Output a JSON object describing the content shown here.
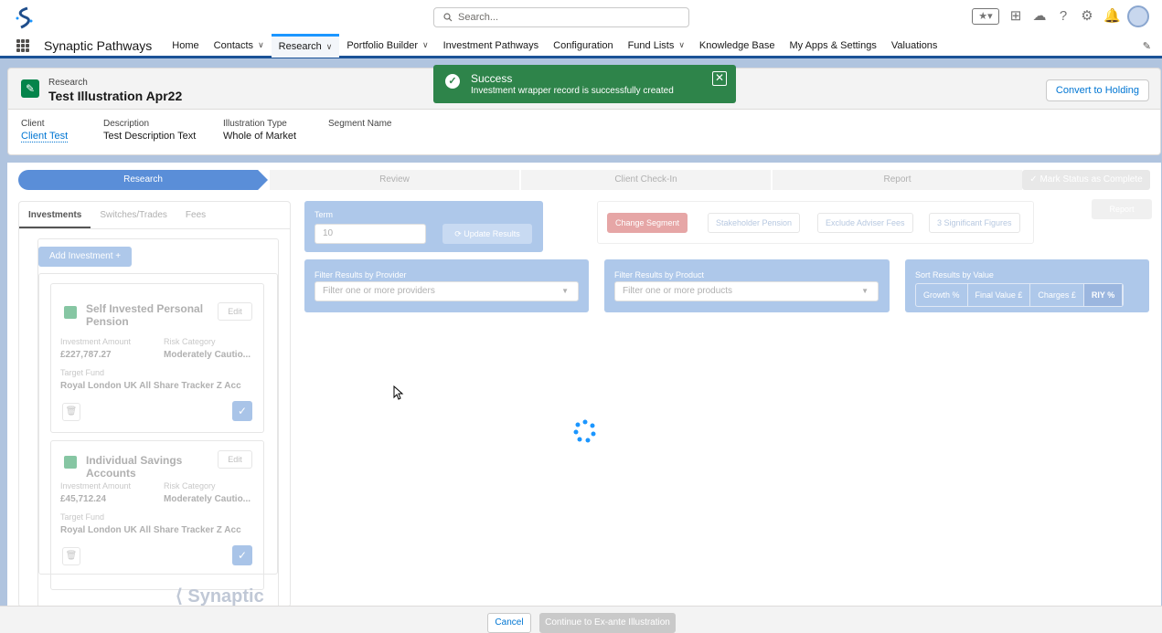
{
  "header": {
    "search_placeholder": "Search...",
    "icons": [
      "favorites-icon",
      "add-icon",
      "trailhead-icon",
      "help-icon",
      "setup-icon",
      "notifications-icon",
      "avatar"
    ]
  },
  "nav": {
    "app_name": "Synaptic Pathways",
    "items": [
      {
        "label": "Home"
      },
      {
        "label": "Contacts",
        "dropdown": true
      },
      {
        "label": "Research",
        "dropdown": true,
        "active": true
      },
      {
        "label": "Portfolio Builder",
        "dropdown": true
      },
      {
        "label": "Investment Pathways"
      },
      {
        "label": "Configuration"
      },
      {
        "label": "Fund Lists",
        "dropdown": true
      },
      {
        "label": "Knowledge Base"
      },
      {
        "label": "My Apps & Settings"
      },
      {
        "label": "Valuations"
      }
    ]
  },
  "record": {
    "type": "Research",
    "title": "Test Illustration Apr22",
    "convert_label": "Convert to Holding",
    "fields": [
      {
        "label": "Client",
        "value": "Client Test"
      },
      {
        "label": "Description",
        "value": "Test Description Text"
      },
      {
        "label": "Illustration Type",
        "value": "Whole of Market"
      },
      {
        "label": "Segment Name",
        "value": ""
      }
    ]
  },
  "toast": {
    "title": "Success",
    "message": "Investment wrapper record is successfully created"
  },
  "path": {
    "steps": [
      "Research",
      "Review",
      "Client Check-In",
      "Report"
    ],
    "mark_label": "✓ Mark Status as Complete"
  },
  "left": {
    "tabs": [
      "Investments",
      "Switches/Trades",
      "Fees"
    ],
    "add_label": "Add Investment +",
    "cards": [
      {
        "title": "Self Invested Personal Pension",
        "edit": "Edit",
        "amount_label": "Investment Amount",
        "amount": "£227,787.27",
        "risk_label": "Risk Category",
        "risk": "Moderately Cautio...",
        "fund_label": "Target Fund",
        "fund": "Royal London UK All Share Tracker Z Acc"
      },
      {
        "title": "Individual Savings Accounts",
        "edit": "Edit",
        "amount_label": "Investment Amount",
        "amount": "£45,712.24",
        "risk_label": "Risk Category",
        "risk": "Moderately Cautio...",
        "fund_label": "Target Fund",
        "fund": "Royal London UK All Share Tracker Z Acc"
      }
    ],
    "logo_text": "Synaptic"
  },
  "term": {
    "label": "Term",
    "value": "10",
    "update_label": "⟳ Update Results"
  },
  "options": {
    "change_segment": "Change Segment",
    "stakeholder": "Stakeholder Pension",
    "exclude_fees": "Exclude Adviser Fees",
    "sig_figs": "3 Significant Figures",
    "report": "Report"
  },
  "filters": {
    "provider_label": "Filter Results by Provider",
    "provider_placeholder": "Filter one or more providers",
    "product_label": "Filter Results by Product",
    "product_placeholder": "Filter one or more products",
    "sort_label": "Sort Results by Value",
    "sort_options": [
      "Growth %",
      "Final Value £",
      "Charges £",
      "RIY %"
    ]
  },
  "footer": {
    "cancel": "Cancel",
    "continue": "Continue to Ex-ante Illustration"
  }
}
